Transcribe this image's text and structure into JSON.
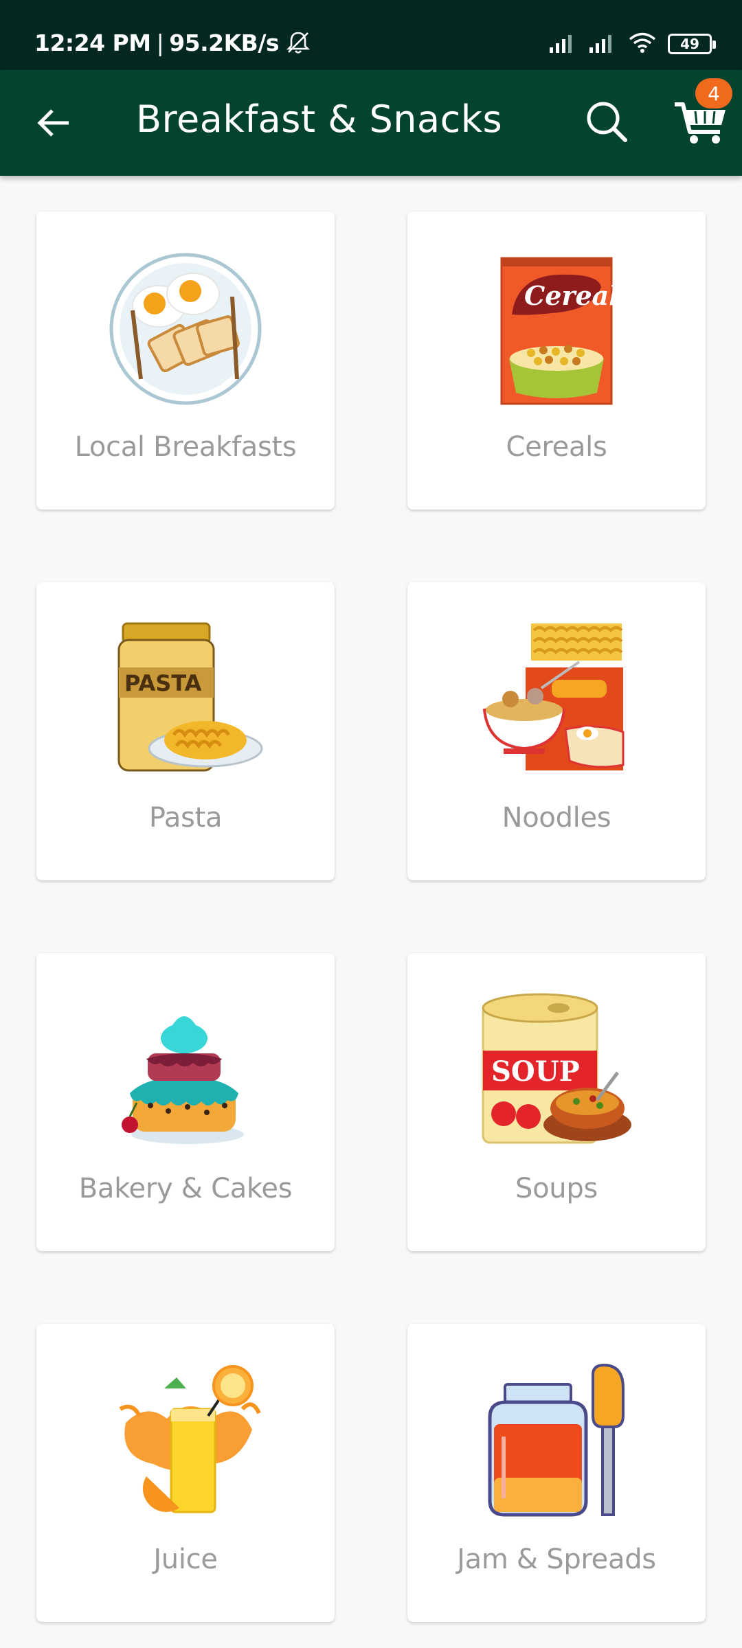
{
  "status_bar": {
    "time": "12:24 PM",
    "separator": "|",
    "speed": "95.2KB/s",
    "battery": "49",
    "icons": [
      "bell-off-icon",
      "signal-icon",
      "signal-icon",
      "wifi-icon",
      "battery-icon"
    ]
  },
  "app_bar": {
    "title": "Breakfast & Snacks",
    "cart_count": "4",
    "colors": {
      "status_bar": "#032821",
      "app_bar": "#04442f",
      "badge": "#ef6a1c"
    }
  },
  "categories": [
    {
      "label": "Local Breakfasts",
      "icon": "breakfast-plate-icon"
    },
    {
      "label": "Cereals",
      "icon": "cereal-box-icon"
    },
    {
      "label": "Pasta",
      "icon": "pasta-jar-icon"
    },
    {
      "label": "Noodles",
      "icon": "noodles-icon"
    },
    {
      "label": "Bakery & Cakes",
      "icon": "cake-icon"
    },
    {
      "label": "Soups",
      "icon": "soup-can-icon"
    },
    {
      "label": "Juice",
      "icon": "juice-glass-icon"
    },
    {
      "label": "Jam & Spreads",
      "icon": "jam-jar-icon"
    }
  ]
}
